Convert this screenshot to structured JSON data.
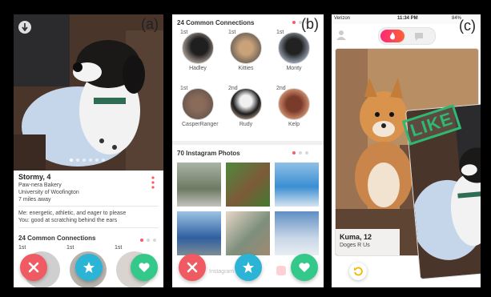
{
  "labels": {
    "a": "(a)",
    "b": "(b)",
    "c": "(c)"
  },
  "panel_a": {
    "dot_count": 6,
    "dot_active": 1,
    "profile_name": "Stormy, 4",
    "work": "Paw-nera Bakery",
    "school": "University of Woofington",
    "distance": "7 miles away",
    "bio_line1": "Me: energetic, athletic, and eager to please",
    "bio_line2": "You: good at scratching behind the ears",
    "connections_title": "24 Common Connections",
    "degrees": [
      "1st",
      "1st",
      "1st"
    ]
  },
  "panel_b": {
    "connections_title": "24 Common Connections",
    "connections": [
      {
        "degree": "1st",
        "name": "Hadley"
      },
      {
        "degree": "1st",
        "name": "Kitties"
      },
      {
        "degree": "1st",
        "name": "Monty"
      },
      {
        "degree": "1st",
        "name": "CasperRanger"
      },
      {
        "degree": "2nd",
        "name": "Rudy"
      },
      {
        "degree": "2nd",
        "name": "Kelp"
      }
    ],
    "instagram_title": "70 Instagram Photos",
    "instagram_footer": "Instagram"
  },
  "panel_c": {
    "carrier": "Verizon",
    "time": "11:34 PM",
    "battery": "84%",
    "stamp": "LIKE",
    "profile_name": "Kuma, 12",
    "work": "Doges R Us"
  },
  "colors": {
    "nope": "#ef5a63",
    "star": "#2bb4d6",
    "like": "#34c98a",
    "brand": "#ff5864"
  },
  "icons": {
    "nope": "close-icon",
    "star": "star-icon",
    "like": "heart-icon",
    "more": "more-vertical-icon",
    "undo": "undo-icon",
    "profile": "profile-icon",
    "flame": "flame-icon",
    "chat": "chat-icon"
  }
}
